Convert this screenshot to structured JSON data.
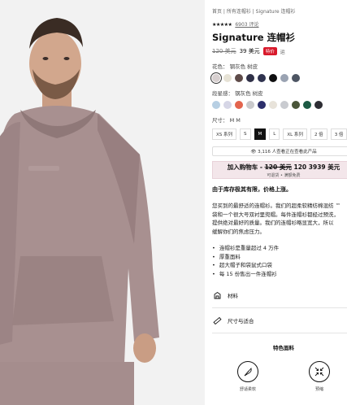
{
  "breadcrumb": "首页 | 所有连帽衫 | Signature 连帽衫",
  "rating": {
    "stars": "★★★★★",
    "count": "6903 评论"
  },
  "product": {
    "title": "Signature 连帽衫",
    "old_price": "120 美元",
    "price": "39 美元",
    "badge": "特价",
    "extra": "运"
  },
  "color": {
    "label": "花色：  钢灰色 树皮",
    "swatches": [
      "#d7cfcf",
      "#e6e2d5",
      "#5e4b49",
      "#2f3047",
      "#30334f",
      "#0f0f10",
      "#9aa3b2",
      "#4d5563"
    ]
  },
  "detail": {
    "label": "段星感：  钢灰色 树皮",
    "swatches": [
      "#b7cfe3",
      "#d6d6e6",
      "#e3654e",
      "#c9c9cb",
      "#2c2f6b",
      "#e8e3da",
      "#c9cbd0",
      "#4a5639",
      "#1c5a44",
      "#2d2d34"
    ]
  },
  "size": {
    "label": "尺寸：  M M",
    "options": [
      "XS 系列",
      "S",
      "M",
      "L",
      "XL 系列",
      "2 倍",
      "3 倍"
    ],
    "selected": "M"
  },
  "stock_notice": "👁 3,116 人查看正在查看此产品",
  "add_to_cart": {
    "label": "加入购物车 - ",
    "old": "120 美元",
    "price": "120 3939 美元",
    "sub": "可退货  •  满额免费"
  },
  "notice": "由于库存极其有限，价格上涨。",
  "description": [
    "您买到的最舒适的连帽衫。我们的超柔软精纺棉混纺 ™",
    "袋和一个很大号双衬里兜帽。每件连帽衫都经过预洗，",
    "提供绝对最好的质量。我们的连帽衫略显宽大，所以",
    "缓解你们的焦虑压力。"
  ],
  "bullets": [
    "连帽衫是重量超过 4 万件",
    "厚重面料",
    "超大帽子和袋鼠式口袋",
    "每 15 份售出一件连帽衫"
  ],
  "links": {
    "material": "材料",
    "size_fit": "尺寸与适合"
  },
  "features": {
    "title": "特色面料",
    "items": [
      "舒适柔软",
      "预缩"
    ]
  }
}
